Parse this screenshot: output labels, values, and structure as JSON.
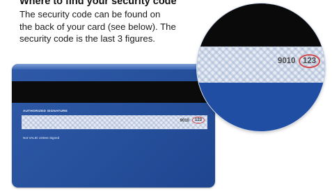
{
  "heading": "Where to find your security code",
  "description": {
    "line1": "The security code can be found on",
    "line2": "the back of your card (see below). The",
    "line3": "security code is the last 3 figures."
  },
  "card": {
    "signature_label": "AUTHORIZED SIGNATURE",
    "card_number_tail": "9010",
    "security_code": "123",
    "disclaimer": "Not VALID Unless Signed"
  },
  "zoom": {
    "card_number_tail": "9010",
    "security_code": "123"
  },
  "colors": {
    "card_blue": "#2a55a0",
    "stripe_black": "#0b0b0b",
    "highlight_red": "#d24a4a"
  }
}
